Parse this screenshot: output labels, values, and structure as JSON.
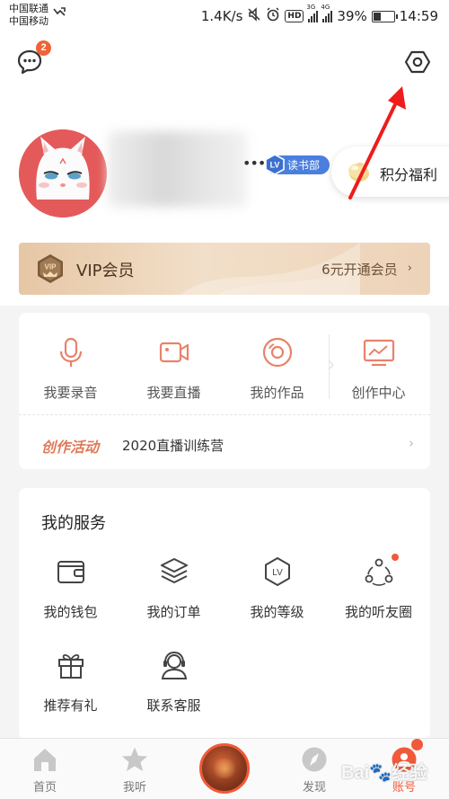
{
  "status_bar": {
    "carrier_1": "中国联通",
    "carrier_2": "中国移动",
    "net_speed": "1.4K/s",
    "hd": "HD",
    "net1": "3G",
    "net2": "4G",
    "battery_text": "39%",
    "battery_level": 0.39,
    "time": "14:59"
  },
  "header": {
    "message_badge": "2",
    "message_icon": "chat-bubble-icon",
    "settings_icon": "hexagon-settings-icon"
  },
  "profile": {
    "level_badge": "LV",
    "level_group": "读书部",
    "points_button": "积分福利"
  },
  "vip": {
    "badge": "VIP",
    "title": "VIP会员",
    "cta": "6元开通会员",
    "chevron": "›"
  },
  "create": {
    "items": [
      {
        "label": "我要录音",
        "icon": "microphone-icon"
      },
      {
        "label": "我要直播",
        "icon": "video-camera-icon"
      },
      {
        "label": "我的作品",
        "icon": "disc-icon"
      },
      {
        "label": "创作中心",
        "icon": "monitor-chart-icon"
      }
    ],
    "activity_label": "创作活动",
    "activity_text": "2020直播训练营",
    "chevron": "›"
  },
  "services": {
    "title": "我的服务",
    "items": [
      {
        "label": "我的钱包",
        "icon": "wallet-icon"
      },
      {
        "label": "我的订单",
        "icon": "layers-icon"
      },
      {
        "label": "我的等级",
        "icon": "level-hexagon-icon"
      },
      {
        "label": "我的听友圈",
        "icon": "friends-circle-icon"
      },
      {
        "label": "推荐有礼",
        "icon": "gift-icon"
      },
      {
        "label": "联系客服",
        "icon": "headset-icon"
      }
    ]
  },
  "bottom_nav": {
    "items": [
      {
        "label": "首页",
        "icon": "home-icon"
      },
      {
        "label": "我听",
        "icon": "star-icon"
      },
      {
        "label": "发现",
        "icon": "compass-icon"
      },
      {
        "label": "账号",
        "icon": "account-icon"
      }
    ]
  },
  "colors": {
    "accent": "#f05a3a",
    "activity": "#e07a5a",
    "vip_gold": "#e6c7a5",
    "level_blue": "#4a7fde"
  }
}
